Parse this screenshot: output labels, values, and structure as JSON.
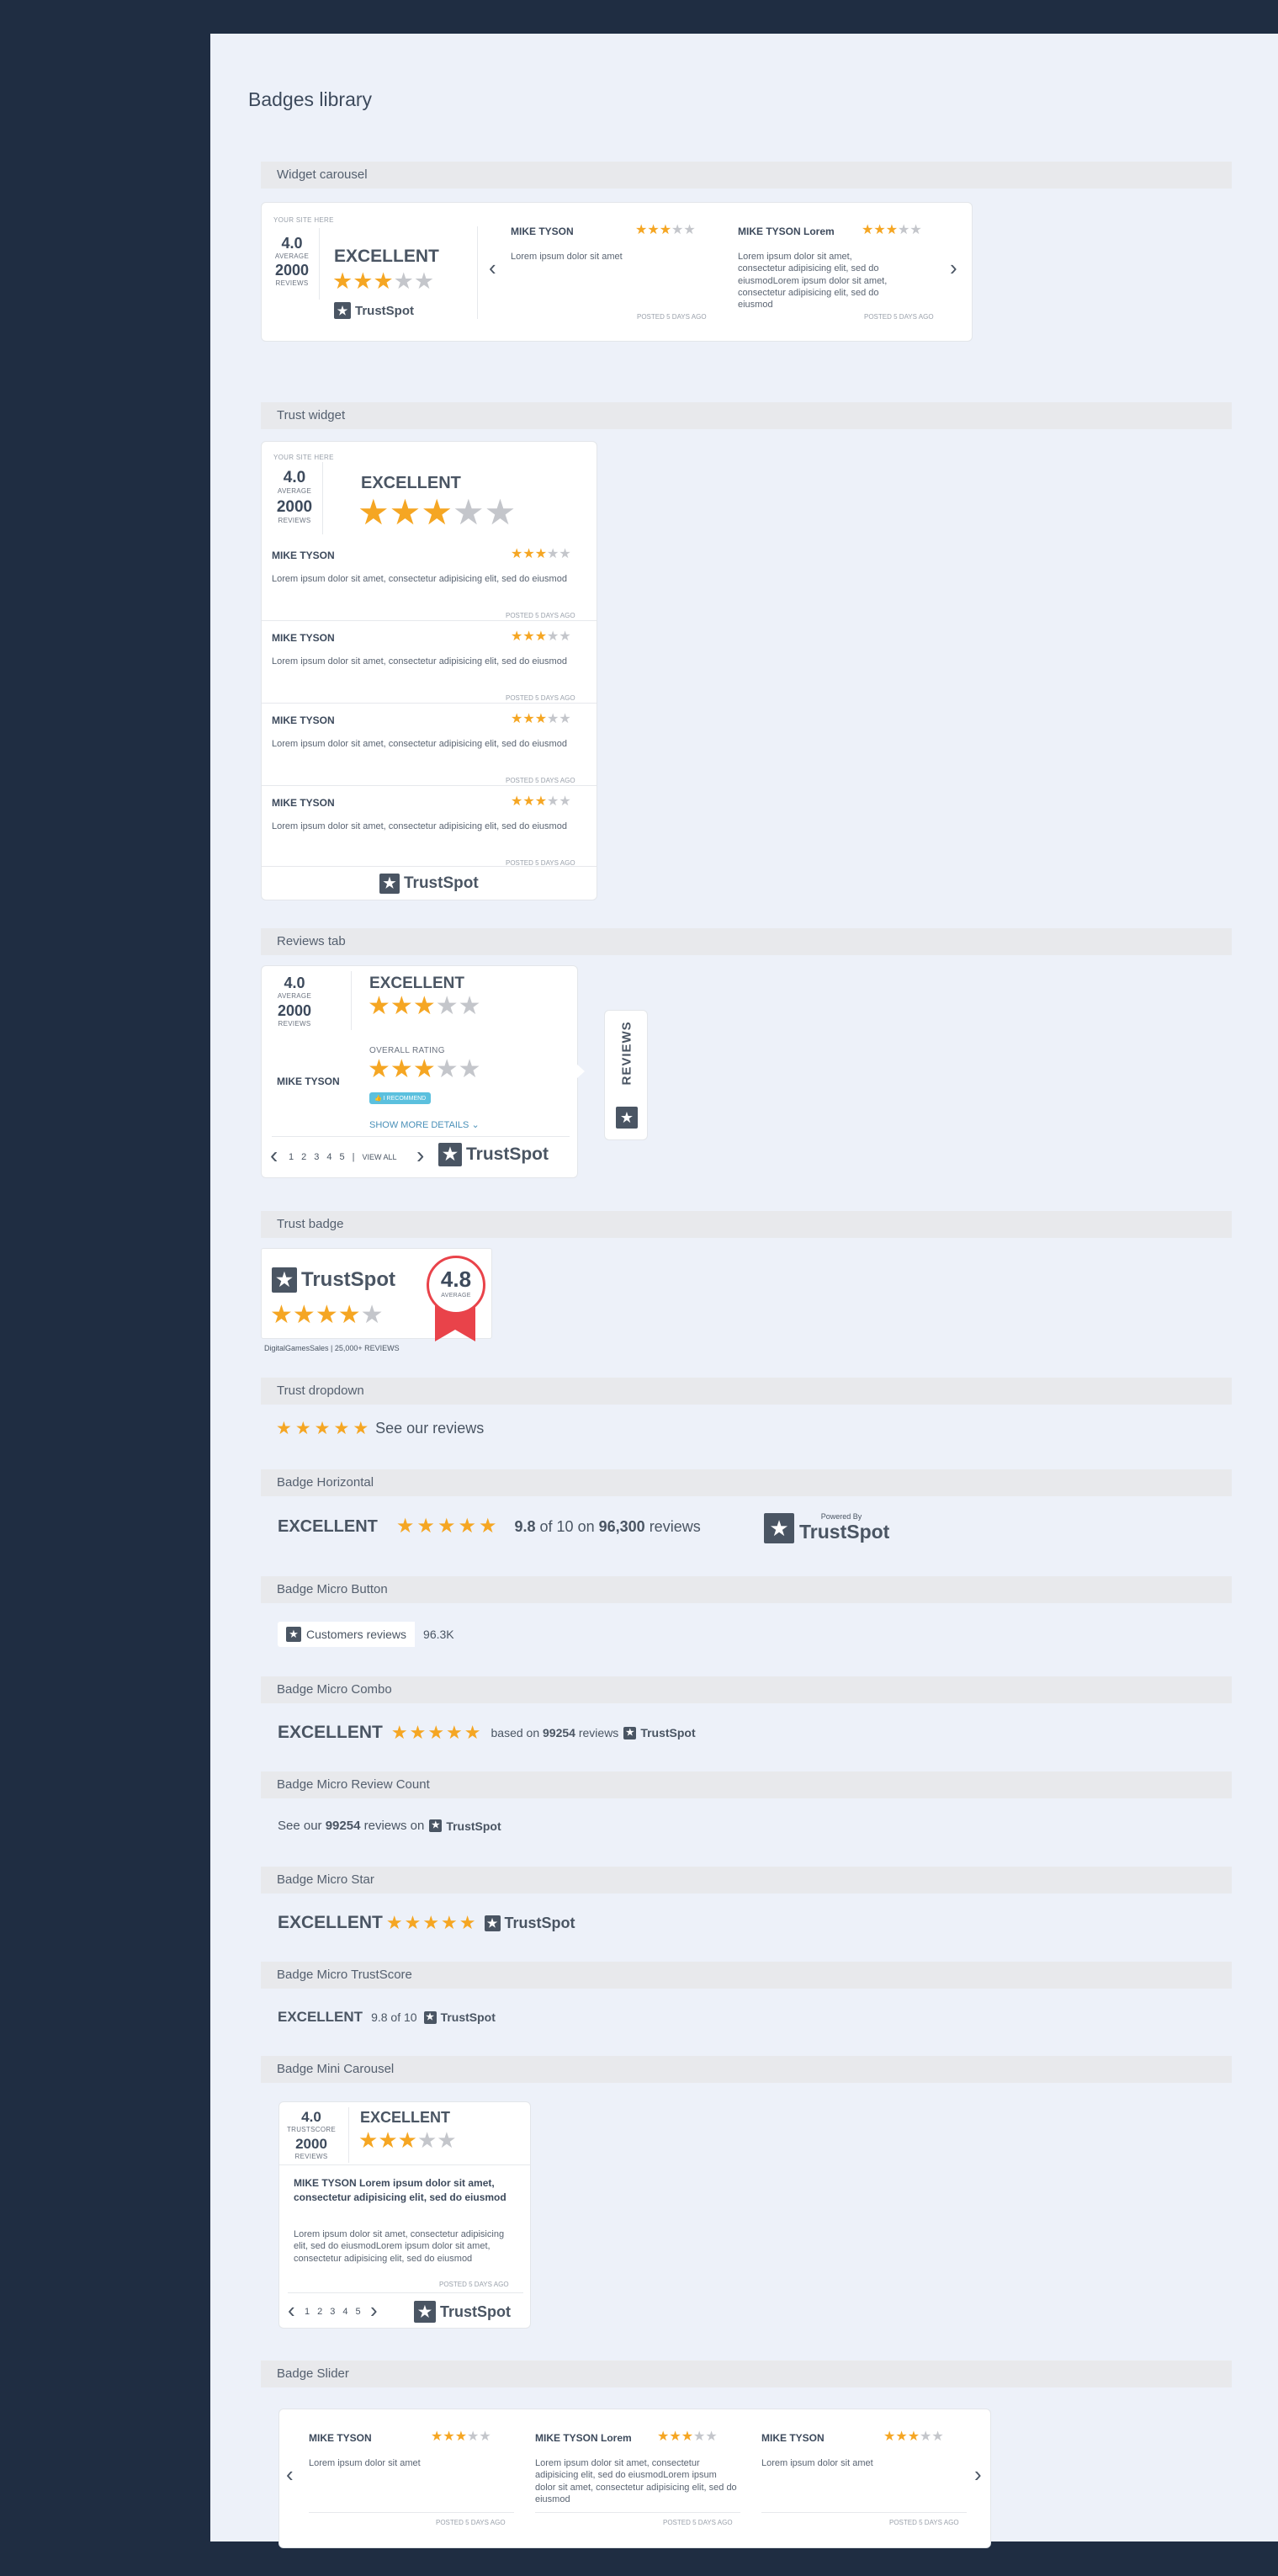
{
  "page": {
    "title": "Badges library"
  },
  "sections": {
    "carousel": "Widget carousel",
    "trust_widget": "Trust widget",
    "reviews_tab": "Reviews tab",
    "trust_badge": "Trust badge",
    "trust_dropdown": "Trust dropdown",
    "badge_horizontal": "Badge Horizontal",
    "micro_button": "Badge Micro Button",
    "micro_combo": "Badge Micro Combo",
    "micro_review_count": "Badge Micro Review Count",
    "micro_star": "Badge Micro Star",
    "micro_trustscore": "Badge Micro TrustScore",
    "mini_carousel": "Badge Mini Carousel",
    "slider": "Badge Slider"
  },
  "common": {
    "site_placeholder": "YOUR SITE HERE",
    "rating": "4.0",
    "average": "AVERAGE",
    "review_count": "2000",
    "reviews_word": "REVIEWS",
    "excellent": "EXCELLENT",
    "brand": "TrustSpot",
    "posted": "POSTED 5 DAYS AGO",
    "lorem_short": "Lorem ipsum dolor sit amet",
    "lorem_medium": "Lorem ipsum dolor sit amet, consectetur adipisicing elit, sed do eiusmod",
    "lorem_long": "Lorem ipsum dolor sit amet, consectetur adipisicing elit, sed do eiusmodLorem ipsum dolor sit amet, consectetur adipisicing elit, sed do eiusmod",
    "name": "MIKE TYSON",
    "name_lorem": "MIKE TYSON Lorem",
    "logo_glyph": "★"
  },
  "reviews_tab": {
    "overall_rating": "OVERALL RATING",
    "recommend": "I RECOMMEND",
    "show_more": "SHOW MORE DETAILS",
    "pages": [
      "1",
      "2",
      "3",
      "4",
      "5"
    ],
    "view_all": "VIEW ALL",
    "tab_label": "REVIEWS"
  },
  "trust_badge": {
    "score": "4.8",
    "average": "AVERAGE",
    "store": "DigitalGamesSales",
    "reviews": "25,000+ REVIEWS"
  },
  "dropdown": {
    "label": "See our reviews"
  },
  "horizontal": {
    "excellent": "EXCELLENT",
    "score": "9.8",
    "of": "of 10 on",
    "count": "96,300",
    "reviews": "reviews",
    "powered_by": "Powered By",
    "brand": "TrustSpot"
  },
  "micro_button": {
    "label": "Customers reviews",
    "count": "96.3K"
  },
  "micro_combo": {
    "excellent": "EXCELLENT",
    "based_on": "based on",
    "count": "99254",
    "reviews": "reviews",
    "brand": "TrustSpot"
  },
  "micro_review_count": {
    "prefix": "See our",
    "count": "99254",
    "suffix": "reviews on",
    "brand": "TrustSpot"
  },
  "micro_star": {
    "excellent": "EXCELLENT",
    "brand": "TrustSpot"
  },
  "micro_trustscore": {
    "excellent": "EXCELLENT",
    "score": "9.8 of 10",
    "brand": "TrustSpot"
  },
  "mini_carousel": {
    "rating": "4.0",
    "trustscore": "TRUSTSCORE",
    "count": "2000",
    "reviews": "REVIEWS",
    "excellent": "EXCELLENT",
    "title": "MIKE TYSON Lorem ipsum dolor sit amet, consectetur adipisicing elit, sed do eiusmod",
    "pages": [
      "1",
      "2",
      "3",
      "4",
      "5"
    ]
  },
  "colors": {
    "star": "#f5a623",
    "star_empty": "#c4c6cb",
    "ribbon": "#e9434a",
    "background": "#1f2d42",
    "panel": "#edf1f9",
    "recommend": "#5bc0de"
  }
}
